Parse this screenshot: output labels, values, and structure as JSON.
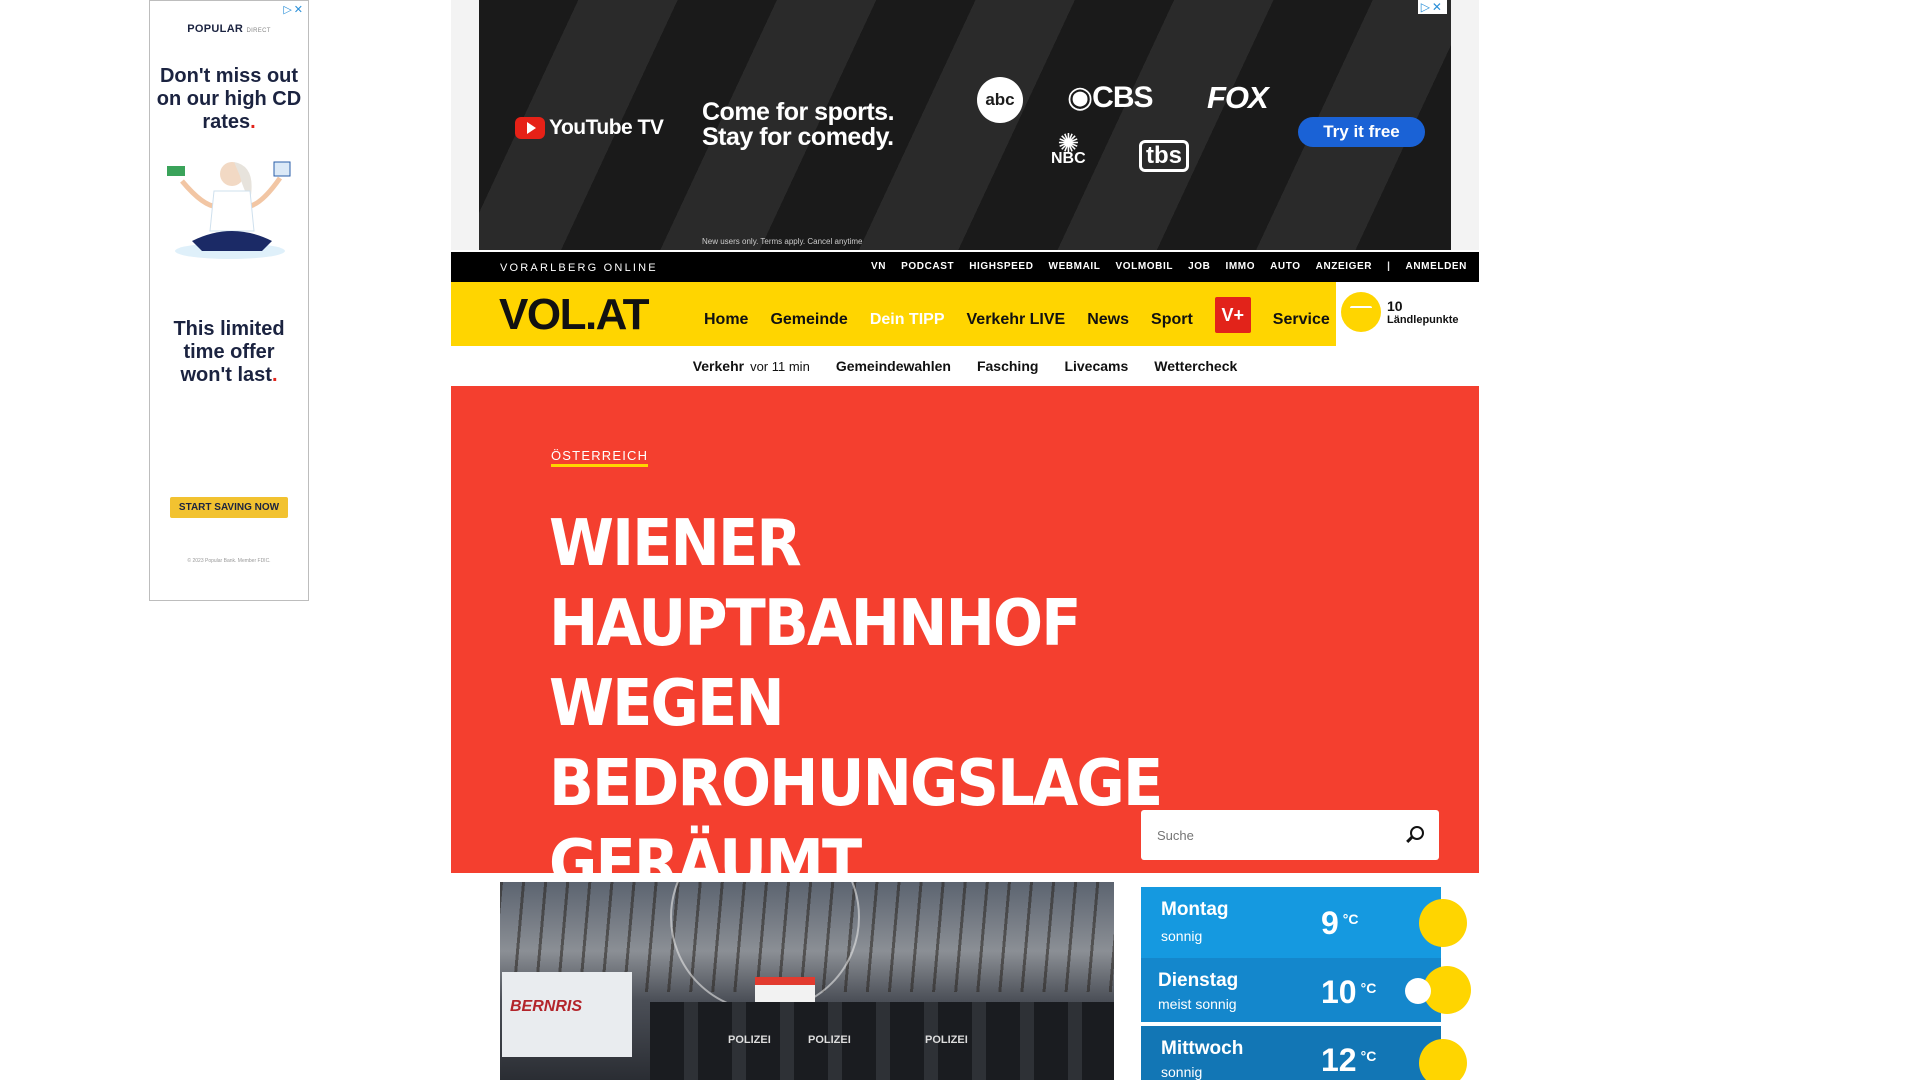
{
  "side_ad": {
    "close_glyph": "▷✕",
    "brand": "POPULAR",
    "brand_sub": "DIRECT",
    "headline1": "Don't miss out on our high CD rates",
    "headline1_dot": ".",
    "headline2": "This limited time offer won't last",
    "headline2_dot": ".",
    "cta": "START SAVING NOW",
    "fineprint": "© 2023 Popular Bank. Member FDIC."
  },
  "top_ad": {
    "close_glyph": "▷✕",
    "brand": "YouTube TV",
    "slogan_line1": "Come for sports.",
    "slogan_line2": "Stay for comedy.",
    "networks": {
      "abc": "abc",
      "cbs": "◉CBS",
      "fox": "FOX",
      "nbc": "NBC",
      "tbs": "tbs"
    },
    "cta": "Try it free",
    "terms": "New users only. Terms apply. Cancel anytime"
  },
  "topbar": {
    "site_name": "VORARLBERG ONLINE",
    "links": [
      "VN",
      "PODCAST",
      "HIGHSPEED",
      "WEBMAIL",
      "VOLMOBIL",
      "JOB",
      "IMMO",
      "AUTO",
      "ANZEIGER"
    ],
    "separator": "|",
    "login": "ANMELDEN"
  },
  "nav": {
    "logo": "VOL.AT",
    "items": [
      "Home",
      "Gemeinde",
      "Dein TIPP",
      "Verkehr LIVE",
      "News",
      "Sport"
    ],
    "vplus": "V+",
    "service": "Service",
    "points_value": "10",
    "points_label": "Ländlepunkte"
  },
  "subnav": {
    "traffic": "Verkehr",
    "traffic_time": "vor 11 min",
    "links": [
      "Gemeindewahlen",
      "Fasching",
      "Livecams",
      "Wettercheck"
    ]
  },
  "hero": {
    "kicker": "ÖSTERREICH",
    "headline": "WIENER HAUPTBAHNHOF WEGEN BEDROHUNGSLAGE GERÄUMT",
    "search_placeholder": "Suche"
  },
  "photo": {
    "truck_text": "BERNRIS",
    "police_labels": [
      "POLIZEI",
      "POLIZEI",
      "POLIZEI"
    ]
  },
  "weather": [
    {
      "day": "Montag",
      "condition": "sonnig",
      "temp": "9",
      "unit": "°C",
      "icon": "sun-icon"
    },
    {
      "day": "Dienstag",
      "condition": "meist sonnig",
      "temp": "10",
      "unit": "°C",
      "icon": "sun-cloud-icon"
    },
    {
      "day": "Mittwoch",
      "condition": "sonnig",
      "temp": "12",
      "unit": "°C",
      "icon": "sun-icon"
    }
  ],
  "colors": {
    "brand_yellow": "#ffd500",
    "hero_red": "#f43f2f",
    "weather_blue": "#1599e0",
    "vplus_red": "#e2231a"
  }
}
